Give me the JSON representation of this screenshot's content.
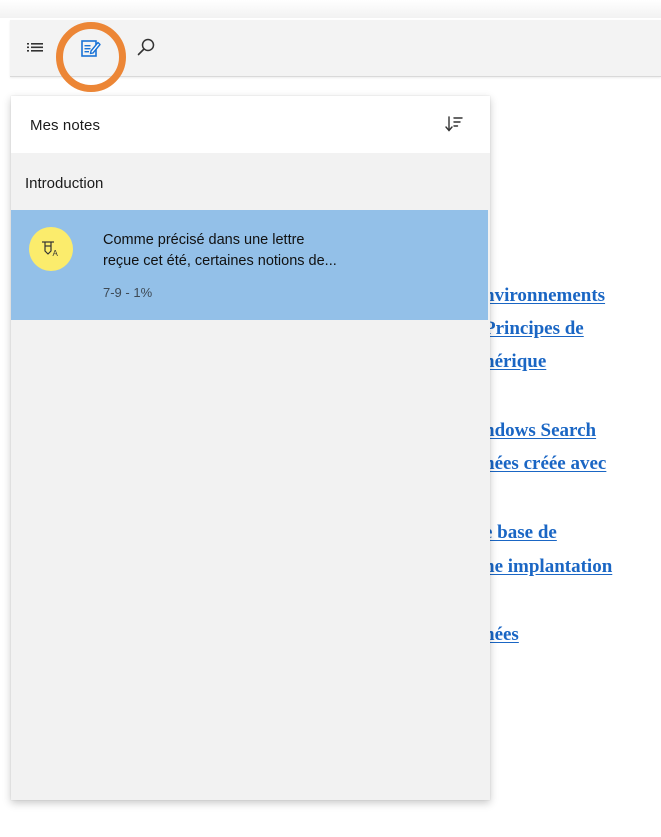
{
  "toolbar": {
    "icons": [
      "table-of-contents-icon",
      "notes-icon",
      "search-icon"
    ],
    "active": "notes-icon",
    "highlight_color": "#ec8636"
  },
  "document": {
    "links": [
      "nvironnements",
      "Principes de",
      "nérique",
      "ndows Search",
      "nées créée avec",
      "e base de",
      "ne implantation",
      "nées"
    ],
    "link_color": "#1a66c4"
  },
  "notes_panel": {
    "title": "Mes notes",
    "sort_icon": "sort-icon",
    "section": "Introduction",
    "notes": [
      {
        "text_line1": "Comme précisé dans une lettre",
        "text_line2": "reçue cet été, certaines notions de...",
        "meta": "7-9 - 1%",
        "icon": "highlight-icon",
        "avatar_color": "#fbec6c",
        "selected_color": "#93c0e8"
      }
    ]
  }
}
